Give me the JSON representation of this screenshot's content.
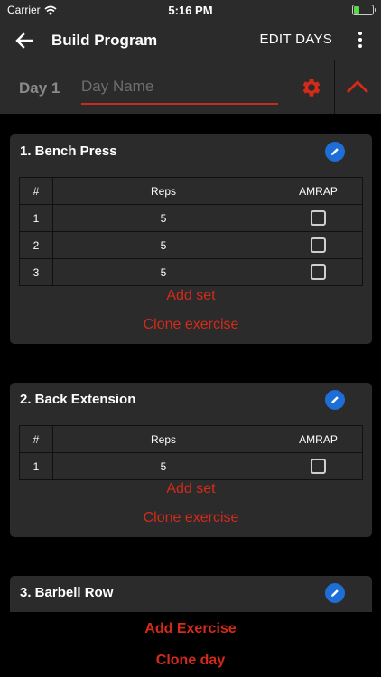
{
  "status_bar": {
    "carrier": "Carrier",
    "time": "5:16 PM",
    "battery_level": 0.3
  },
  "header": {
    "title": "Build Program",
    "edit_days_label": "EDIT DAYS"
  },
  "day": {
    "label": "Day 1",
    "name_placeholder": "Day Name",
    "name_value": ""
  },
  "table_headers": {
    "number": "#",
    "reps": "Reps",
    "amrap": "AMRAP"
  },
  "exercises": [
    {
      "title": "1. Bench Press",
      "sets": [
        {
          "number": "1",
          "reps": "5",
          "amrap": false
        },
        {
          "number": "2",
          "reps": "5",
          "amrap": false
        },
        {
          "number": "3",
          "reps": "5",
          "amrap": false
        }
      ],
      "add_set_label": "Add set",
      "clone_label": "Clone exercise"
    },
    {
      "title": "2. Back Extension",
      "sets": [
        {
          "number": "1",
          "reps": "5",
          "amrap": false
        }
      ],
      "add_set_label": "Add set",
      "clone_label": "Clone exercise"
    },
    {
      "title": "3. Barbell Row"
    }
  ],
  "footer": {
    "add_exercise_label": "Add Exercise",
    "clone_day_label": "Clone day"
  },
  "colors": {
    "accent": "#d42a1a",
    "edit_button": "#1e6ed8",
    "surface": "#2b2b2b",
    "background": "#000000"
  },
  "icons": {
    "back": "arrow-left-icon",
    "more": "more-vertical-icon",
    "settings": "gear-icon",
    "collapse": "chevron-up-icon",
    "edit": "pencil-icon",
    "wifi": "wifi-icon",
    "battery": "battery-icon"
  }
}
